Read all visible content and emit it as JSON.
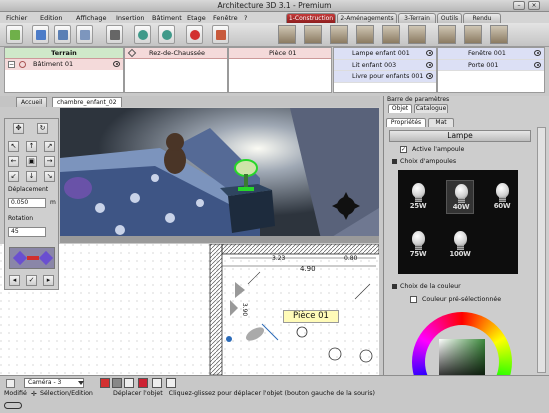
{
  "window": {
    "title": "Architecture 3D 3.1 - Premium"
  },
  "menu": [
    "Fichier",
    "Edition",
    "Affichage",
    "Insertion",
    "Bâtiment",
    "Etage",
    "Fenêtre",
    "?"
  ],
  "mode_tabs": [
    {
      "label": "1-Construction",
      "active": true
    },
    {
      "label": "2-Aménagements",
      "active": false
    },
    {
      "label": "3-Terrain",
      "active": false
    },
    {
      "label": "Outils",
      "active": false
    },
    {
      "label": "Rendu",
      "active": false
    }
  ],
  "project": {
    "terrain_header": "Terrain",
    "building": "Bâtiment 01",
    "floor": "Rez-de-Chaussée",
    "room": "Pièce 01",
    "objects": [
      "Lampe enfant 001",
      "Lit enfant 003",
      "Livre pour enfants 001"
    ],
    "openings": [
      "Fenêtre 001",
      "Porte 001"
    ]
  },
  "view_tabs": [
    "Accueil",
    "chambre_enfant_02"
  ],
  "nav": {
    "displacement_label": "Déplacement",
    "displacement_value": "0.050",
    "displacement_unit": "m",
    "rotation_label": "Rotation",
    "rotation_value": "45"
  },
  "plan": {
    "room_label": "Pièce 01",
    "dim_1": "3.23",
    "dim_2": "0.80",
    "dim_3": "4.90",
    "dim_4": "3.90"
  },
  "params": {
    "panel_title": "Barre de paramètres",
    "tabs": [
      "Objet",
      "Catalogue"
    ],
    "subtabs": [
      "Propriétés",
      "Mat"
    ],
    "object_name": "Lampe",
    "active_lamp": "Active l'ampoule",
    "bulb_section": "Choix d'ampoules",
    "bulbs": [
      "25W",
      "40W",
      "60W",
      "75W",
      "100W"
    ],
    "selected_bulb": "40W",
    "color_section": "Choix de la couleur",
    "preselected_color": "Couleur pré-sélectionnée"
  },
  "status": {
    "camera": "Caméra - 3",
    "mode": "Modifié",
    "tool": "Sélection/Edition",
    "hint": "Déplacer l'objet   Cliquez-glissez pour déplacer l'objet (bouton gauche de la souris)"
  },
  "colors": {
    "accent": "#9e2424",
    "selection": "#2a6ab8"
  }
}
